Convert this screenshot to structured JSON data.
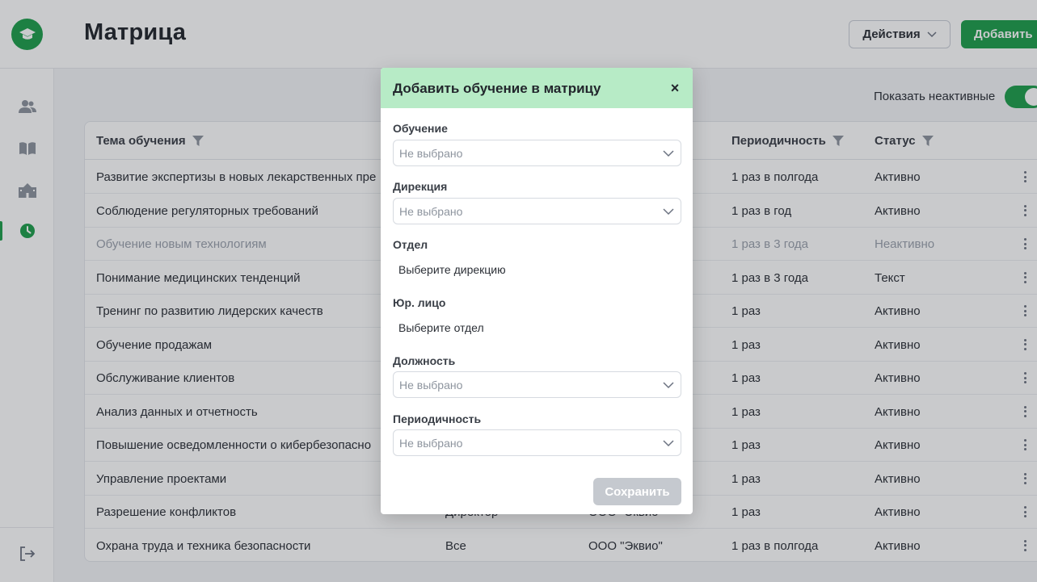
{
  "header": {
    "title": "Матрица",
    "actions_label": "Действия",
    "add_label": "Добавить"
  },
  "sidebar": {
    "items": [
      {
        "icon": "users-icon"
      },
      {
        "icon": "book-icon"
      },
      {
        "icon": "building-icon"
      },
      {
        "icon": "clock-icon",
        "active": true
      }
    ],
    "logout_icon": "logout-icon"
  },
  "filters": {
    "show_inactive_label": "Показать неактивные",
    "show_inactive": true
  },
  "table": {
    "columns": {
      "topic": "Тема обучения",
      "periodicity": "Периодичность",
      "status": "Статус"
    },
    "rows": [
      {
        "topic": "Развитие экспертизы в новых лекарственных пре",
        "position": "",
        "entity": "",
        "periodicity": "1 раз в полгода",
        "status": "Активно",
        "inactive": false
      },
      {
        "topic": "Соблюдение регуляторных требований",
        "position": "",
        "entity": "",
        "periodicity": "1 раз в год",
        "status": "Активно",
        "inactive": false
      },
      {
        "topic": "Обучение новым технологиям",
        "position": "",
        "entity": "",
        "periodicity": "1 раз в 3 года",
        "status": "Неактивно",
        "inactive": true
      },
      {
        "topic": "Понимание медицинских тенденций",
        "position": "",
        "entity": "",
        "periodicity": "1 раз в 3 года",
        "status": "Текст",
        "inactive": false
      },
      {
        "topic": "Тренинг по развитию лидерских качеств",
        "position": "",
        "entity": "",
        "periodicity": "1 раз",
        "status": "Активно",
        "inactive": false
      },
      {
        "topic": "Обучение продажам",
        "position": "",
        "entity": "",
        "periodicity": "1 раз",
        "status": "Активно",
        "inactive": false
      },
      {
        "topic": "Обслуживание клиентов",
        "position": "",
        "entity": "",
        "periodicity": "1 раз",
        "status": "Активно",
        "inactive": false
      },
      {
        "topic": "Анализ данных и отчетность",
        "position": "",
        "entity": "",
        "periodicity": "1 раз",
        "status": "Активно",
        "inactive": false
      },
      {
        "topic": "Повышение осведомленности о кибербезопасно",
        "position": "",
        "entity": "",
        "periodicity": "1 раз",
        "status": "Активно",
        "inactive": false
      },
      {
        "topic": "Управление проектами",
        "position": "",
        "entity": "",
        "periodicity": "1 раз",
        "status": "Активно",
        "inactive": false
      },
      {
        "topic": "Разрешение конфликтов",
        "position": "Директор",
        "entity": "ООО \"Эквио\"",
        "periodicity": "1 раз",
        "status": "Активно",
        "inactive": false
      },
      {
        "topic": "Охрана труда и техника безопасности",
        "position": "Все",
        "entity": "ООО \"Эквио\"",
        "periodicity": "1 раз в полгода",
        "status": "Активно",
        "inactive": false
      }
    ]
  },
  "modal": {
    "title": "Добавить обучение в матрицу",
    "close_label": "×",
    "fields": {
      "training": {
        "label": "Обучение",
        "placeholder": "Не выбрано"
      },
      "direction": {
        "label": "Дирекция",
        "placeholder": "Не выбрано"
      },
      "department": {
        "label": "Отдел",
        "text": "Выберите дирекцию"
      },
      "legal_entity": {
        "label": "Юр. лицо",
        "text": "Выберите отдел"
      },
      "position": {
        "label": "Должность",
        "placeholder": "Не выбрано"
      },
      "periodicity": {
        "label": "Периодичность",
        "placeholder": "Не выбрано"
      }
    },
    "save_label": "Сохранить"
  },
  "colors": {
    "brand": "#1e9e4b",
    "modal_header": "#b7ebc6",
    "save_disabled": "#c5c9cf"
  }
}
